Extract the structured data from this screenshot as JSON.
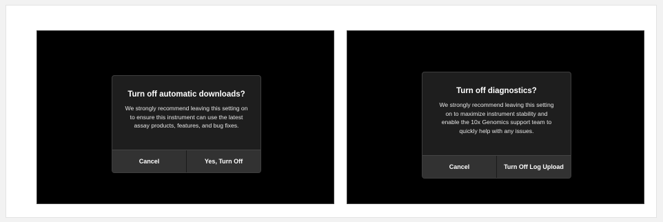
{
  "left_dialog": {
    "title": "Turn off automatic downloads?",
    "message": "We strongly recommend leaving this setting on to ensure this instrument can use the latest assay products, features, and bug fixes.",
    "cancel_label": "Cancel",
    "confirm_label": "Yes, Turn Off"
  },
  "right_dialog": {
    "title": "Turn off diagnostics?",
    "message": "We strongly recommend leaving this setting on to maximize instrument stability and enable the 10x Genomics support team to quickly help with any issues.",
    "cancel_label": "Cancel",
    "confirm_label": "Turn Off Log Upload"
  },
  "colors": {
    "screen_background": "#000000",
    "dialog_background": "#1e1e1e",
    "button_bar": "#323232",
    "text": "#ffffff"
  }
}
